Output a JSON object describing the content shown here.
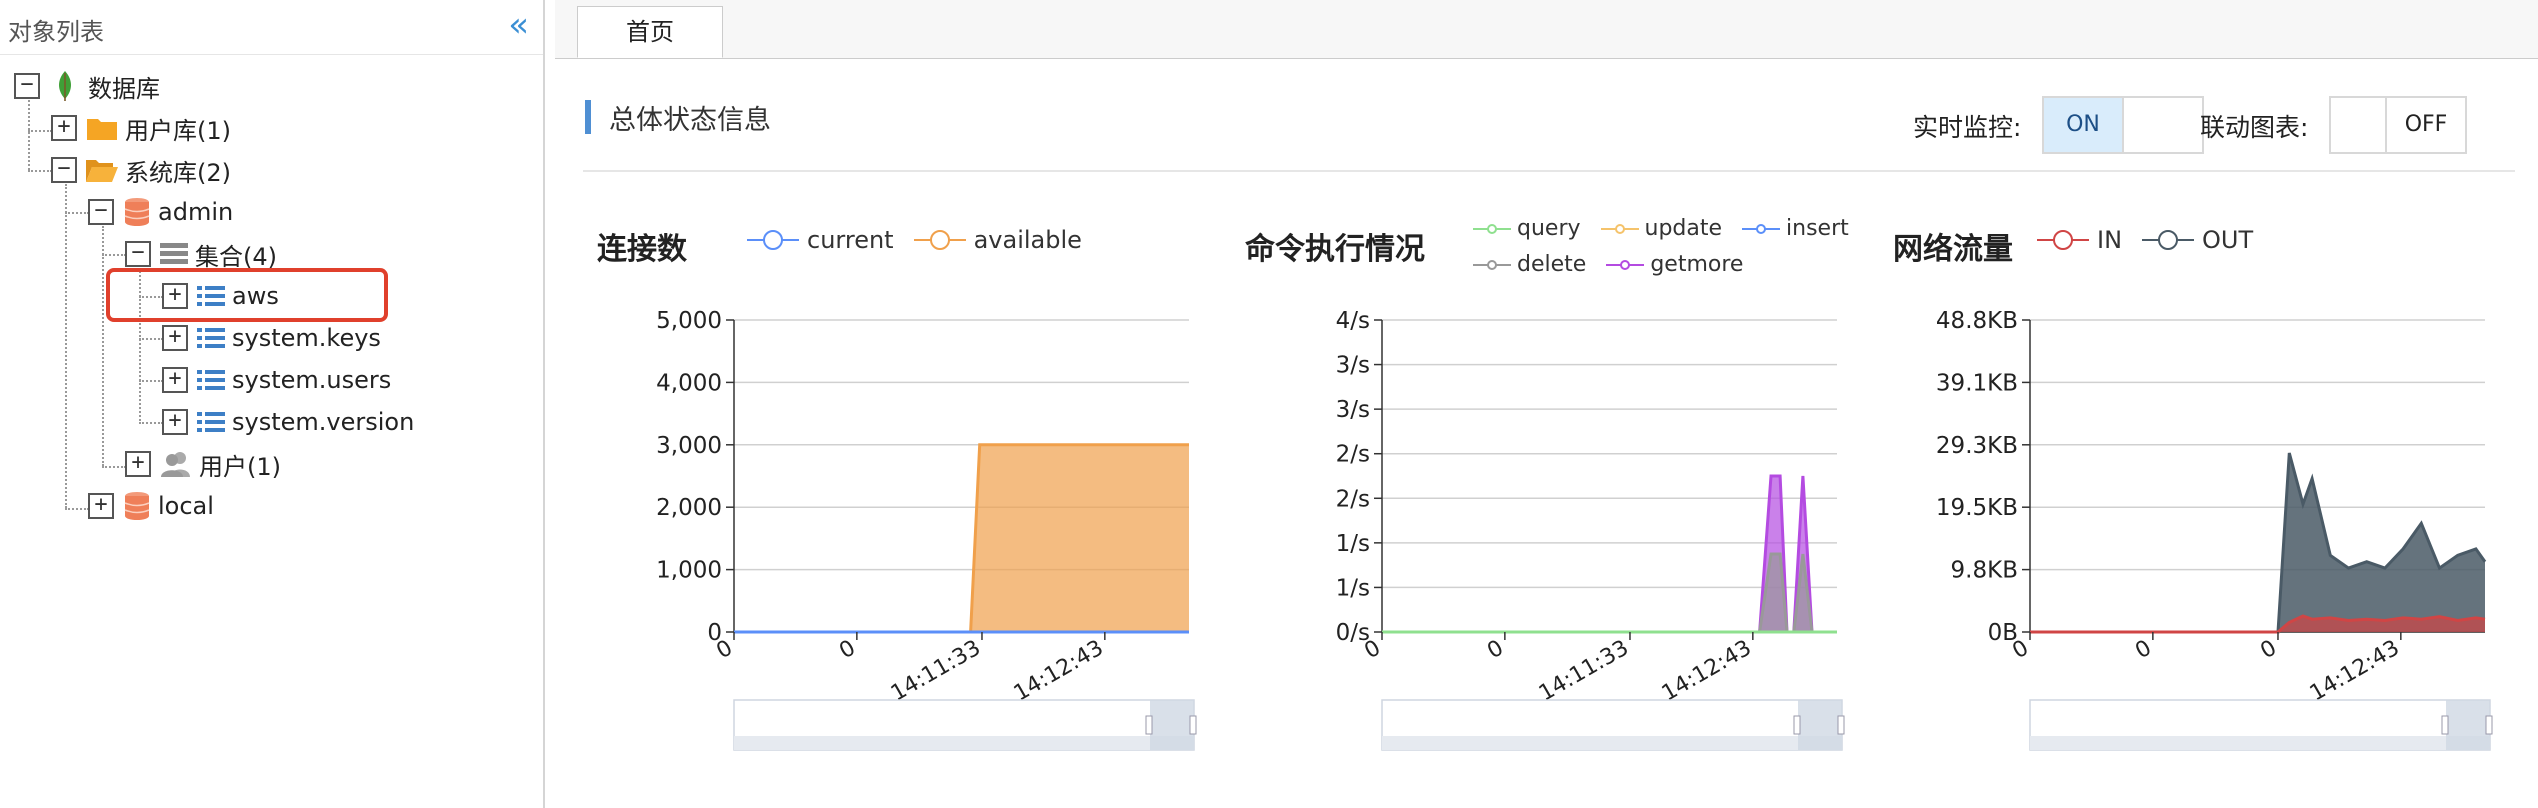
{
  "sidebar": {
    "title": "对象列表",
    "collapse_glyph": "«",
    "tree": {
      "root": {
        "label": "数据库",
        "toggle": "−"
      },
      "user_dbs": {
        "label": "用户库(1)",
        "toggle": "+"
      },
      "system_dbs": {
        "label": "系统库(2)",
        "toggle": "−"
      },
      "admin": {
        "label": "admin",
        "toggle": "−"
      },
      "collections": {
        "label": "集合(4)",
        "toggle": "−"
      },
      "coll_aws": {
        "label": "aws",
        "toggle": "+"
      },
      "coll_system_keys": {
        "label": "system.keys",
        "toggle": "+"
      },
      "coll_system_users": {
        "label": "system.users",
        "toggle": "+"
      },
      "coll_system_version": {
        "label": "system.version",
        "toggle": "+"
      },
      "users": {
        "label": "用户(1)",
        "toggle": "+"
      },
      "local": {
        "label": "local",
        "toggle": "+"
      }
    }
  },
  "tabs": [
    {
      "label": "首页"
    }
  ],
  "section": {
    "title": "总体状态信息"
  },
  "controls": {
    "realtime": {
      "label": "实时监控:",
      "on": "ON",
      "off": ""
    },
    "linked": {
      "label": "联动图表:",
      "on": "",
      "off": "OFF"
    }
  },
  "colors": {
    "accent": "#4f8fd3",
    "highlight": "#e0402c",
    "available": "#f0a04b",
    "getmore": "#b44be1",
    "out": "#4a5a66",
    "in": "#d04545"
  },
  "chart_data": [
    {
      "type": "area",
      "title": "连接数",
      "legend": [
        "current",
        "available"
      ],
      "y_ticks": [
        "5,000",
        "4,000",
        "3,000",
        "2,000",
        "1,000",
        "0"
      ],
      "x_ticks": [
        "0",
        "0",
        "14:11:33",
        "14:12:43"
      ],
      "ylim": [
        0,
        5000
      ],
      "x": [
        0,
        0.52,
        0.54,
        1
      ],
      "series": [
        {
          "name": "current",
          "color": "#5b8ff9",
          "values": [
            0,
            0,
            0,
            0
          ]
        },
        {
          "name": "available",
          "color": "#f0a04b",
          "values": [
            0,
            0,
            3000,
            3000
          ]
        }
      ]
    },
    {
      "type": "area",
      "title": "命令执行情况",
      "legend": [
        "query",
        "update",
        "insert",
        "delete",
        "getmore"
      ],
      "y_ticks": [
        "4/s",
        "3/s",
        "3/s",
        "2/s",
        "2/s",
        "1/s",
        "1/s",
        "0/s"
      ],
      "x_ticks": [
        "0",
        "0",
        "14:11:33",
        "14:12:43"
      ],
      "ylim": [
        0,
        4
      ],
      "x": [
        0,
        0.83,
        0.855,
        0.875,
        0.89,
        0.905,
        0.925,
        0.945,
        1
      ],
      "series": [
        {
          "name": "query",
          "color": "#8fe08f",
          "values": [
            0,
            0,
            0,
            0,
            0,
            0,
            0,
            0,
            0
          ]
        },
        {
          "name": "update",
          "color": "#f5c36b",
          "values": [
            0,
            0,
            0,
            0,
            0,
            0,
            0,
            0,
            0
          ]
        },
        {
          "name": "insert",
          "color": "#5b8ff9",
          "values": [
            0,
            0,
            0,
            0,
            0,
            0,
            0,
            0,
            0
          ]
        },
        {
          "name": "delete",
          "color": "#999999",
          "values": [
            0,
            0,
            1.0,
            1.0,
            0,
            0,
            1.0,
            0,
            0
          ]
        },
        {
          "name": "getmore",
          "color": "#b44be1",
          "values": [
            0,
            0,
            2.0,
            2.0,
            0,
            0,
            2.0,
            0,
            0
          ]
        }
      ]
    },
    {
      "type": "area",
      "title": "网络流量",
      "legend": [
        "IN",
        "OUT"
      ],
      "y_ticks": [
        "48.8KB",
        "39.1KB",
        "29.3KB",
        "19.5KB",
        "9.8KB",
        "0B"
      ],
      "x_ticks": [
        "0",
        "0",
        "0",
        "14:12:43"
      ],
      "ylim": [
        0,
        48.8
      ],
      "x": [
        0,
        0.545,
        0.57,
        0.6,
        0.62,
        0.66,
        0.7,
        0.74,
        0.78,
        0.82,
        0.86,
        0.9,
        0.94,
        0.98,
        1
      ],
      "series": [
        {
          "name": "IN",
          "color": "#d04545",
          "values": [
            0,
            0,
            1.5,
            2.5,
            2.0,
            2.2,
            1.8,
            2.0,
            1.8,
            2.2,
            2.0,
            2.4,
            1.8,
            2.2,
            2.0
          ]
        },
        {
          "name": "OUT",
          "color": "#4a5a66",
          "values": [
            0,
            0,
            28,
            20,
            24,
            12,
            10,
            11,
            10,
            13,
            17,
            10,
            12,
            13,
            11
          ]
        }
      ]
    }
  ]
}
